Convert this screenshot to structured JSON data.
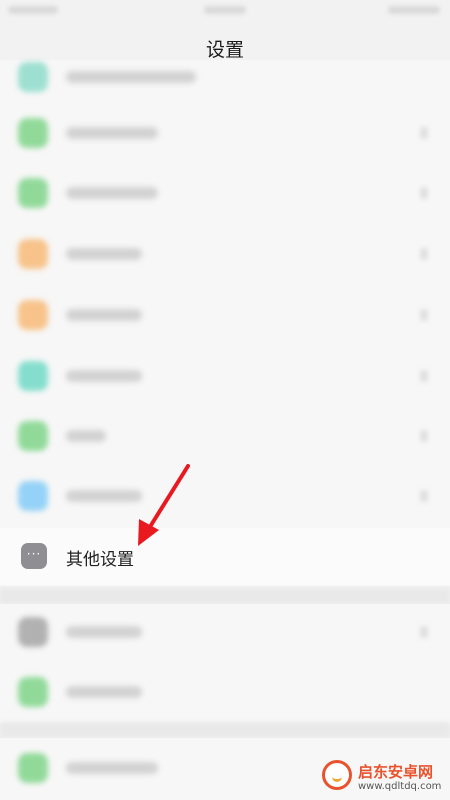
{
  "header": {
    "title": "设置"
  },
  "list": {
    "other_settings": {
      "icon": "more-dots-icon",
      "icon_glyph": "···",
      "label": "其他设置"
    }
  },
  "blurred_rows": [
    {
      "icon": "app-icon",
      "color": "#7fd8c4"
    },
    {
      "icon": "app-icon",
      "color": "#6fd07a"
    },
    {
      "icon": "app-icon",
      "color": "#6fd07a"
    },
    {
      "icon": "app-icon",
      "color": "#f7b267"
    },
    {
      "icon": "app-icon",
      "color": "#f7b267"
    },
    {
      "icon": "app-icon",
      "color": "#5fd6c0"
    },
    {
      "icon": "app-icon",
      "color": "#6fd07a"
    },
    {
      "icon": "app-icon",
      "color": "#74c6f7"
    },
    {
      "icon": "app-icon",
      "color": "#9a9a9a"
    },
    {
      "icon": "app-icon",
      "color": "#6fd07a"
    },
    {
      "icon": "app-icon",
      "color": "#6fd07a"
    }
  ],
  "annotation": {
    "arrow_color": "#e8191f"
  },
  "watermark": {
    "title": "启东安卓网",
    "url": "www.qdltdq.com",
    "brand_color": "#e8532e"
  }
}
